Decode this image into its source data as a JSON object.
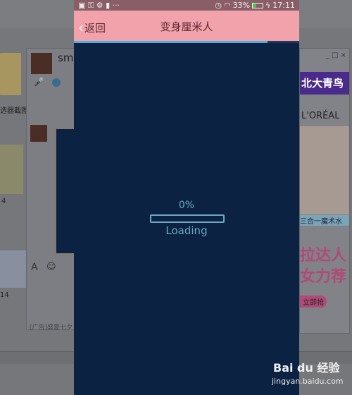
{
  "status_bar": {
    "battery": "33%",
    "time": "17:11",
    "dots": "···"
  },
  "header": {
    "back_label": "返回",
    "title": "变身厘米人"
  },
  "top_progress": 0.86,
  "loading": {
    "percent_text": "0%",
    "progress": 0,
    "label": "Loading"
  },
  "background": {
    "desktop_labels": [
      "选器截图",
      "4",
      "14"
    ],
    "chat": {
      "name": "smi",
      "ad_text": "[广告]盛夏七夕"
    },
    "ad": {
      "headline": "北大青鸟",
      "brand": "L'ORÉAL",
      "product": "三合一魔术水",
      "line1": "拉达人",
      "line2": "女力荐",
      "cta": "立即抢"
    }
  },
  "watermark": {
    "brand": "Bai du 经验",
    "url": "jingyan.baidu.com"
  },
  "colors": {
    "header": "#f2a2aa",
    "screen": "#0b2243",
    "accent": "#6aa8c4"
  }
}
